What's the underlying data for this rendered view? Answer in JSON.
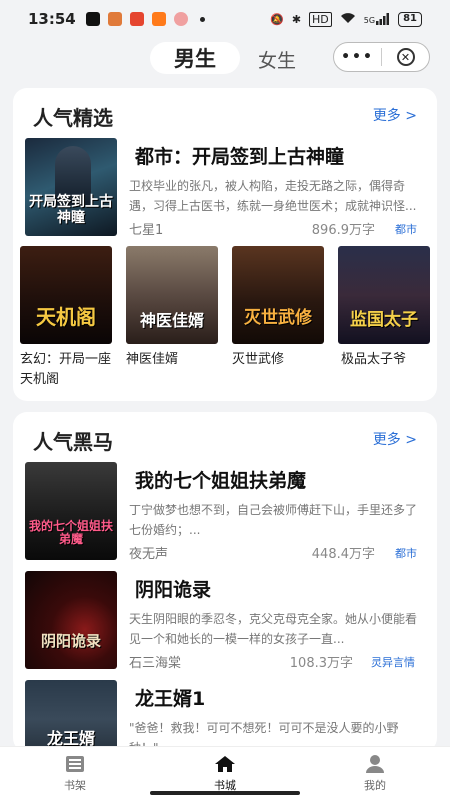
{
  "status": {
    "time": "13:54",
    "battery": "81",
    "signal_text": "5G",
    "hd_text": "HD"
  },
  "tabs": {
    "active": "男生",
    "inactive": "女生"
  },
  "section1": {
    "title": "人气精选",
    "more": "更多 >",
    "featured": {
      "title": "都市：开局签到上古神瞳",
      "desc": "卫校毕业的张凡，被人构陷，走投无路之际，偶得奇遇，习得上古医书，练就一身绝世医术；成就神识怪...",
      "author": "七星1",
      "count": "896.9万字",
      "tag": "都市",
      "cover_text": "开局签到上古神瞳"
    },
    "grid": [
      {
        "title": "玄幻：开局一座天机阁",
        "cover_text": "天机阁"
      },
      {
        "title": "神医佳婿",
        "cover_text": "神医佳婿"
      },
      {
        "title": "灭世武修",
        "cover_text": "灭世武修"
      },
      {
        "title": "极品太子爷",
        "cover_text": "监国太子"
      }
    ]
  },
  "section2": {
    "title": "人气黑马",
    "more": "更多 >",
    "books": [
      {
        "title": "我的七个姐姐扶弟魔",
        "desc": "丁宁做梦也想不到，自己会被师傅赶下山，手里还多了七份婚约；...",
        "author": "夜无声",
        "count": "448.4万字",
        "tag": "都市",
        "cover_text": "我的七个姐姐扶弟魔"
      },
      {
        "title": "阴阳诡录",
        "desc": "天生阴阳眼的季忍冬，克父克母克全家。她从小便能看见一个和她长的一模一样的女孩子一直...",
        "author": "石三海棠",
        "count": "108.3万字",
        "tag": "灵异言情",
        "cover_text": "阴阳诡录"
      },
      {
        "title": "龙王婿1",
        "desc": "\"爸爸！救我！可可不想死！可可不是没人要的小野种！\"...",
        "author": "",
        "count": "",
        "tag": "",
        "cover_text": "龙王婿"
      }
    ]
  },
  "nav": {
    "shelf": "书架",
    "store": "书城",
    "mine": "我的"
  }
}
